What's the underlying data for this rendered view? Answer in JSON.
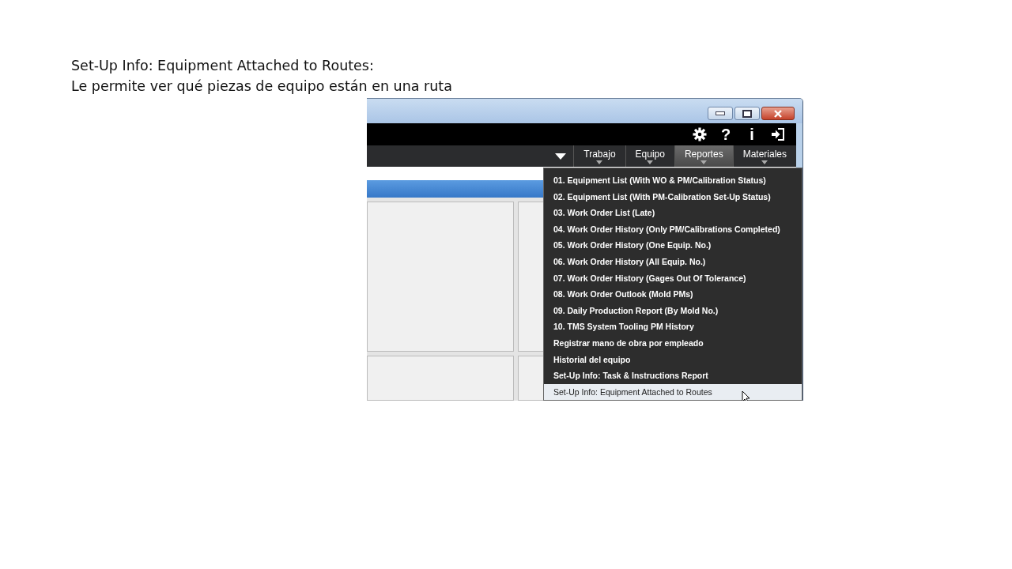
{
  "slide": {
    "title": "Set-Up Info: Equipment Attached to Routes:",
    "subtitle": "Le permite ver qué piezas de equipo están en una ruta"
  },
  "window": {
    "toolbar_symbols": [
      "?",
      "i"
    ],
    "tabs": [
      {
        "label": "Trabajo",
        "selected": false
      },
      {
        "label": "Equipo",
        "selected": false
      },
      {
        "label": "Reportes",
        "selected": true
      },
      {
        "label": "Materiales",
        "selected": false
      }
    ],
    "menu": [
      {
        "label": "01. Equipment List (With WO & PM/Calibration Status)",
        "selected": false
      },
      {
        "label": "02. Equipment List (With PM-Calibration Set-Up Status)",
        "selected": false
      },
      {
        "label": "03. Work Order List (Late)",
        "selected": false
      },
      {
        "label": "04. Work Order History (Only PM/Calibrations Completed)",
        "selected": false
      },
      {
        "label": "05. Work Order History (One Equip. No.)",
        "selected": false
      },
      {
        "label": "06. Work Order History (All Equip. No.)",
        "selected": false
      },
      {
        "label": "07. Work Order History (Gages Out Of Tolerance)",
        "selected": false
      },
      {
        "label": "08. Work Order Outlook (Mold PMs)",
        "selected": false
      },
      {
        "label": "09. Daily Production Report (By Mold No.)",
        "selected": false
      },
      {
        "label": "10. TMS System Tooling PM History",
        "selected": false
      },
      {
        "label": "Registrar mano de obra por empleado",
        "selected": false
      },
      {
        "label": "Historial del equipo",
        "selected": false
      },
      {
        "label": "Set-Up Info: Task & Instructions Report",
        "selected": false
      },
      {
        "label": "Set-Up Info: Equipment Attached to Routes",
        "selected": true
      }
    ]
  }
}
